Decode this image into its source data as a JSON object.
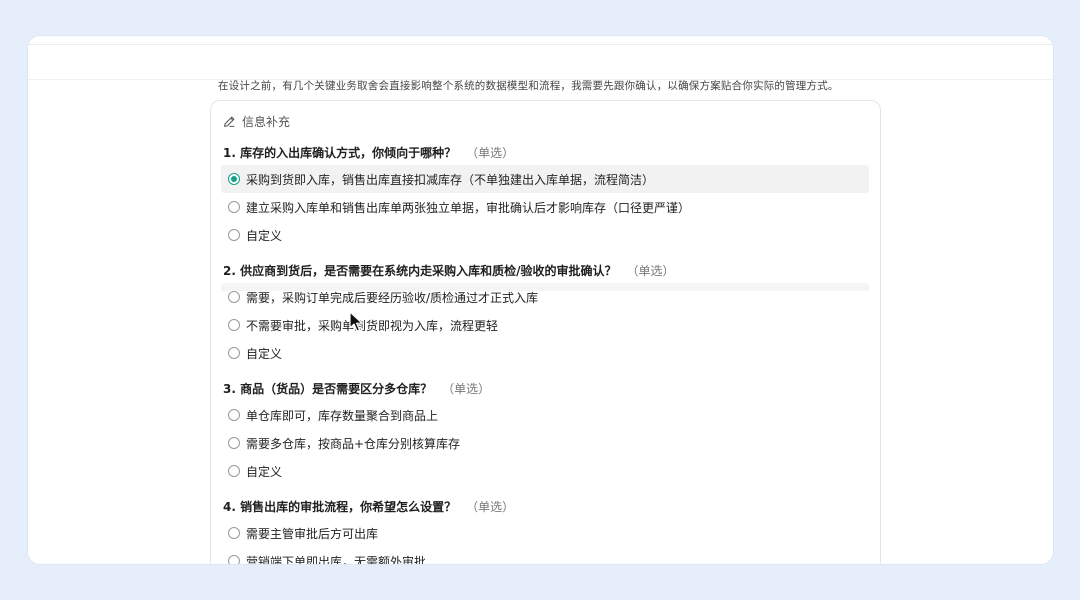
{
  "intro_text": "在设计之前，有几个关键业务取舍会直接影响整个系统的数据模型和流程，我需要先跟你确认，以确保方案贴合你实际的管理方式。",
  "card": {
    "title": "信息补充",
    "title_icon": "pencil-icon"
  },
  "questions": [
    {
      "title": "1. 库存的入出库确认方式，你倾向于哪种？",
      "tag": "（单选）",
      "options": [
        {
          "label": "采购到货即入库，销售出库直接扣减库存（不单独建出入库单据，流程简洁）",
          "selected": true
        },
        {
          "label": "建立采购入库单和销售出库单两张独立单据，审批确认后才影响库存（口径更严谨）",
          "selected": false
        },
        {
          "label": "自定义",
          "selected": false
        }
      ]
    },
    {
      "title": "2. 供应商到货后，是否需要在系统内走采购入库和质检/验收的审批确认？",
      "tag": "（单选）",
      "options": [
        {
          "label": "需要，采购订单完成后要经历验收/质检通过才正式入库",
          "selected": false
        },
        {
          "label": "不需要审批，采购单到货即视为入库，流程更轻",
          "selected": false
        },
        {
          "label": "自定义",
          "selected": false
        }
      ]
    },
    {
      "title": "3. 商品（货品）是否需要区分多仓库？",
      "tag": "（单选）",
      "options": [
        {
          "label": "单仓库即可，库存数量聚合到商品上",
          "selected": false
        },
        {
          "label": "需要多仓库，按商品+仓库分别核算库存",
          "selected": false
        },
        {
          "label": "自定义",
          "selected": false
        }
      ]
    },
    {
      "title": "4. 销售出库的审批流程，你希望怎么设置？",
      "tag": "（单选）",
      "options": [
        {
          "label": "需要主管审批后方可出库",
          "selected": false
        },
        {
          "label": "营销端下单即出库，无需额外审批",
          "selected": false
        }
      ]
    }
  ],
  "colors": {
    "accent": "#12a088",
    "background": "#e6eefb"
  }
}
